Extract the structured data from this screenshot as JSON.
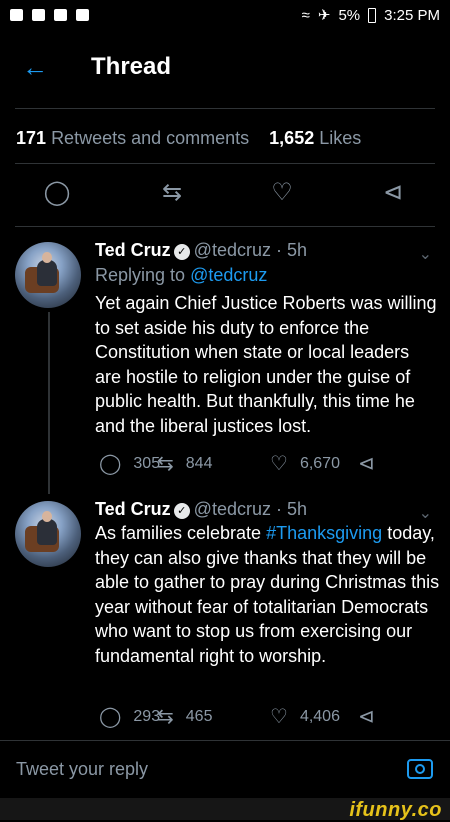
{
  "status_bar": {
    "battery": "5%",
    "time": "3:25 PM"
  },
  "header": {
    "title": "Thread"
  },
  "engagement": {
    "retweets_count": "171",
    "retweets_label": "Retweets and comments",
    "likes_count": "1,652",
    "likes_label": "Likes"
  },
  "tweets": [
    {
      "name": "Ted Cruz",
      "handle": "@tedcruz",
      "time": "5h",
      "replying_to_prefix": "Replying to",
      "replying_to": "@tedcruz",
      "text": "Yet again Chief Justice Roberts was willing to set aside his duty to enforce the Constitution when state or local leaders are hostile to religion under the guise of public health. But thankfully, this time he and the liberal justices lost.",
      "replies": "305",
      "retweets": "844",
      "likes": "6,670"
    },
    {
      "name": "Ted Cruz",
      "handle": "@tedcruz",
      "time": "5h",
      "text_before": "As families celebrate",
      "hashtag": "#Thanksgiving",
      "text_after": "today, they can also give thanks that they will be able to gather to pray during Christmas this year without fear of totalitarian Democrats who want to stop us from exercising our fundamental right to worship.",
      "replies": "293",
      "retweets": "465",
      "likes": "4,406"
    }
  ],
  "reply_bar": {
    "placeholder": "Tweet your reply"
  },
  "watermark": "ifunny.co",
  "icons": {
    "back": "arrow-left-icon",
    "reply": "speech-bubble-icon",
    "retweet": "retweet-icon",
    "like": "heart-icon",
    "share": "share-icon",
    "camera": "camera-icon",
    "verified": "verified-badge-icon"
  },
  "colors": {
    "accent": "#1d9bf0",
    "background": "#000000",
    "muted": "#8b98a5"
  }
}
